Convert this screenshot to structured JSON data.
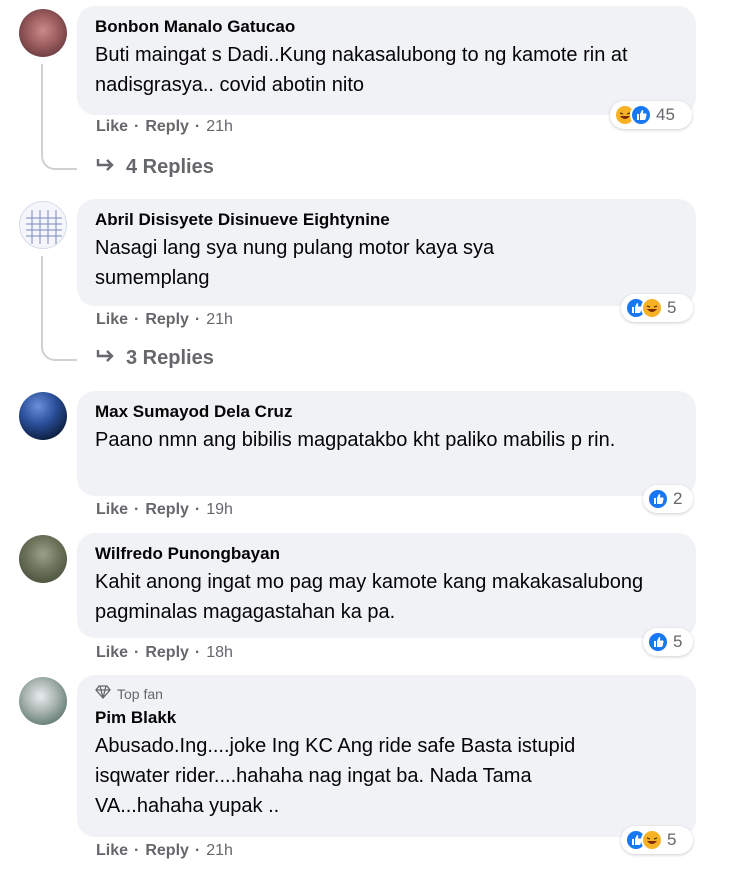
{
  "comments": [
    {
      "author": "Bonbon Manalo Gatucao",
      "text": "Buti maingat s Dadi..Kung nakasalubong to ng kamote rin at nadisgrasya.. covid abotin nito",
      "like": "Like",
      "reply": "Reply",
      "time": "21h",
      "reaction_count": "45",
      "reactions": [
        "haha",
        "like"
      ],
      "replies_label": "4 Replies"
    },
    {
      "author": "Abril Disisyete Disinueve Eightynine",
      "text": "Nasagi lang sya nung pulang motor kaya sya sumemplang",
      "like": "Like",
      "reply": "Reply",
      "time": "21h",
      "reaction_count": "5",
      "reactions": [
        "like",
        "haha"
      ],
      "replies_label": "3 Replies"
    },
    {
      "author": "Max Sumayod Dela Cruz",
      "text": "Paano nmn ang bibilis magpatakbo kht paliko mabilis p rin.",
      "like": "Like",
      "reply": "Reply",
      "time": "19h",
      "reaction_count": "2",
      "reactions": [
        "like"
      ]
    },
    {
      "author": "Wilfredo Punongbayan",
      "text": "Kahit anong ingat mo pag may kamote kang makakasalubong pagminalas magagastahan ka pa.",
      "like": "Like",
      "reply": "Reply",
      "time": "18h",
      "reaction_count": "5",
      "reactions": [
        "like"
      ]
    },
    {
      "badge": "Top fan",
      "author": "Pim Blakk",
      "text": "Abusado.Ing....joke Ing KC Ang ride safe Basta istupid isqwater rider....hahaha nag ingat ba. Nada Tama VA...hahaha yupak ..",
      "like": "Like",
      "reply": "Reply",
      "time": "21h",
      "reaction_count": "5",
      "reactions": [
        "like",
        "haha"
      ]
    }
  ],
  "colors": {
    "like": "#1877f2",
    "haha": "#f7b125",
    "muted": "#65676b",
    "bubble": "#f0f2f5"
  }
}
